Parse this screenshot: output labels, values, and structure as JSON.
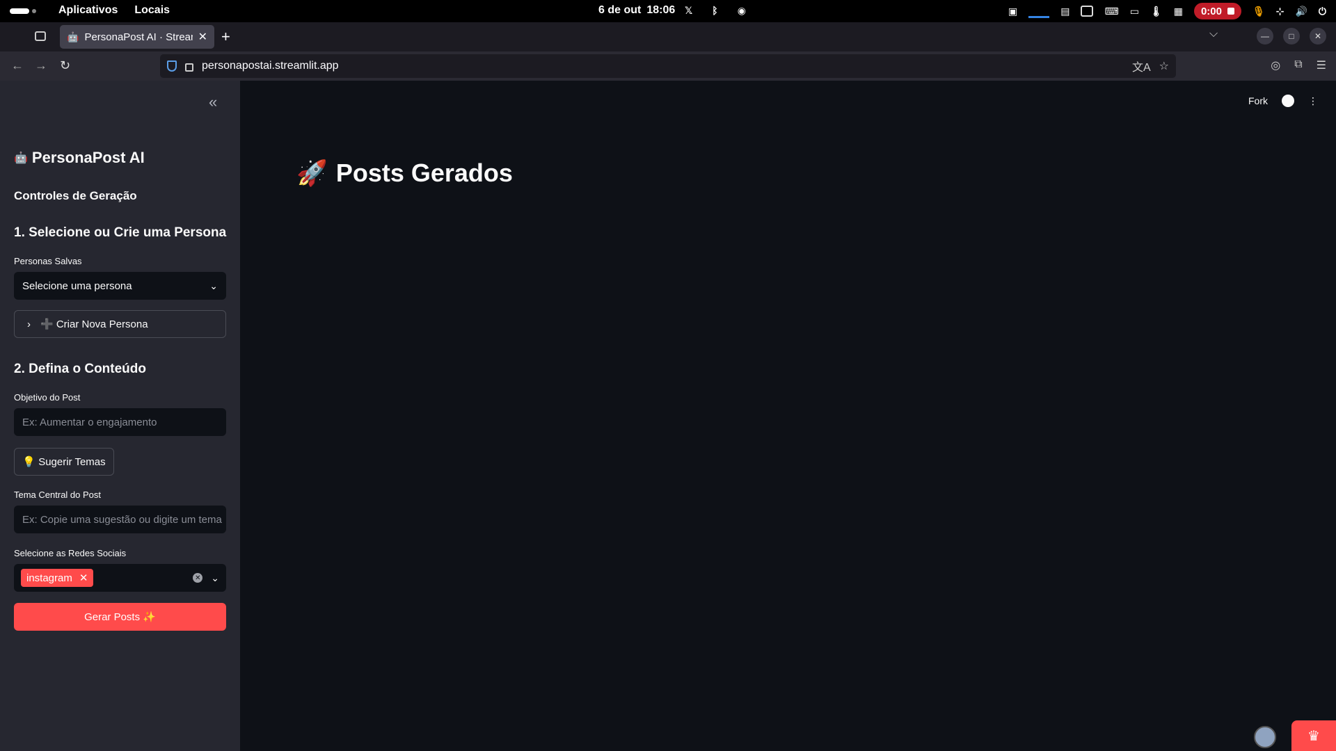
{
  "os_bar": {
    "menu": [
      "Aplicativos",
      "Locais"
    ],
    "date": "6 de out",
    "time": "18:06",
    "recording_time": "0:00"
  },
  "browser": {
    "tab_title": "PersonaPost AI · Streamlit",
    "tab_favicon": "robot-icon",
    "url": "personapostai.streamlit.app"
  },
  "sidebar": {
    "app_title": "PersonaPost AI",
    "app_icon": "robot-icon",
    "controls_heading": "Controles de Geração",
    "section1_heading": "1. Selecione ou Crie uma Persona",
    "personas_label": "Personas Salvas",
    "personas_select": "Selecione uma persona",
    "create_persona": "➕ Criar Nova Persona",
    "section2_heading": "2. Defina o Conteúdo",
    "objective_label": "Objetivo do Post",
    "objective_placeholder": "Ex: Aumentar o engajamento",
    "suggest_button": "💡 Sugerir Temas",
    "theme_label": "Tema Central do Post",
    "theme_placeholder": "Ex: Copie uma sugestão ou digite um tema",
    "networks_label": "Selecione as Redes Sociais",
    "networks_selected": [
      "instagram"
    ],
    "generate_button": "Gerar Posts ✨"
  },
  "main": {
    "header_fork": "Fork",
    "page_title": "Posts Gerados",
    "page_title_icon": "🚀"
  },
  "colors": {
    "accent": "#ff4b4b",
    "background": "#0e1117",
    "sidebar": "#262730"
  }
}
